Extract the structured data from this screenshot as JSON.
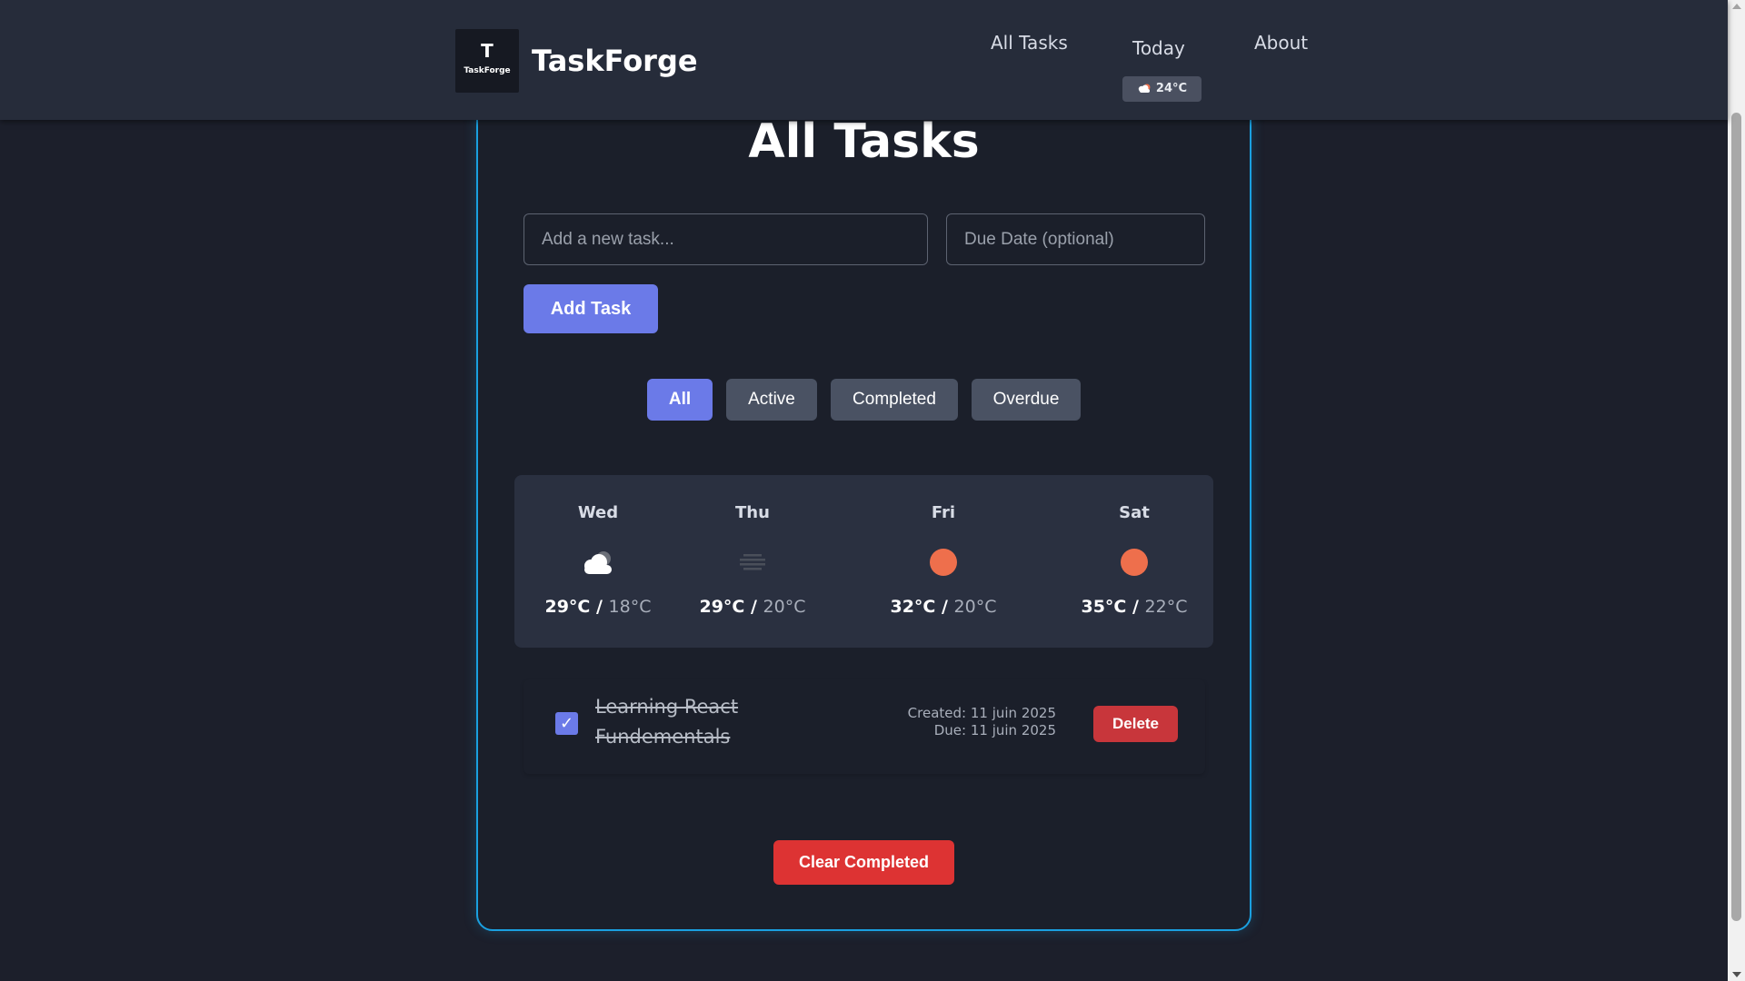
{
  "header": {
    "logo": {
      "letter": "T",
      "word": "TaskForge",
      "icon": "taskforge-logo"
    },
    "brand": "TaskForge",
    "nav": [
      {
        "label": "All Tasks"
      },
      {
        "label": "Today"
      },
      {
        "label": "About"
      }
    ],
    "weather": {
      "icon": "cloud-sun-icon",
      "temp": "24°C"
    }
  },
  "main": {
    "title": "All Tasks",
    "task_input": {
      "placeholder": "Add a new task...",
      "value": ""
    },
    "date_input": {
      "placeholder": "Due Date (optional)",
      "value": ""
    },
    "add_button": "Add Task",
    "filters": [
      {
        "label": "All",
        "active": true
      },
      {
        "label": "Active",
        "active": false
      },
      {
        "label": "Completed",
        "active": false
      },
      {
        "label": "Overdue",
        "active": false
      }
    ],
    "forecast": [
      {
        "day": "Wed",
        "icon": "cloudy-icon",
        "high": "29°C",
        "low": "18°C"
      },
      {
        "day": "Thu",
        "icon": "fog-icon",
        "high": "29°C",
        "low": "20°C"
      },
      {
        "day": "Fri",
        "icon": "sun-icon",
        "high": "32°C",
        "low": "20°C"
      },
      {
        "day": "Sat",
        "icon": "sun-icon",
        "high": "35°C",
        "low": "22°C"
      }
    ],
    "tasks": [
      {
        "text": "Learning React Fundementals",
        "completed": true,
        "created": "Created: 11 juin 2025",
        "due": "Due: 11 juin 2025",
        "delete_label": "Delete"
      }
    ],
    "clear_button": "Clear Completed"
  },
  "colors": {
    "accent": "#6b7ae8",
    "danger": "#dd3333",
    "panel_border": "#1aa0e0",
    "background": "#1c1f2b",
    "sun": "#ee6f4c"
  }
}
